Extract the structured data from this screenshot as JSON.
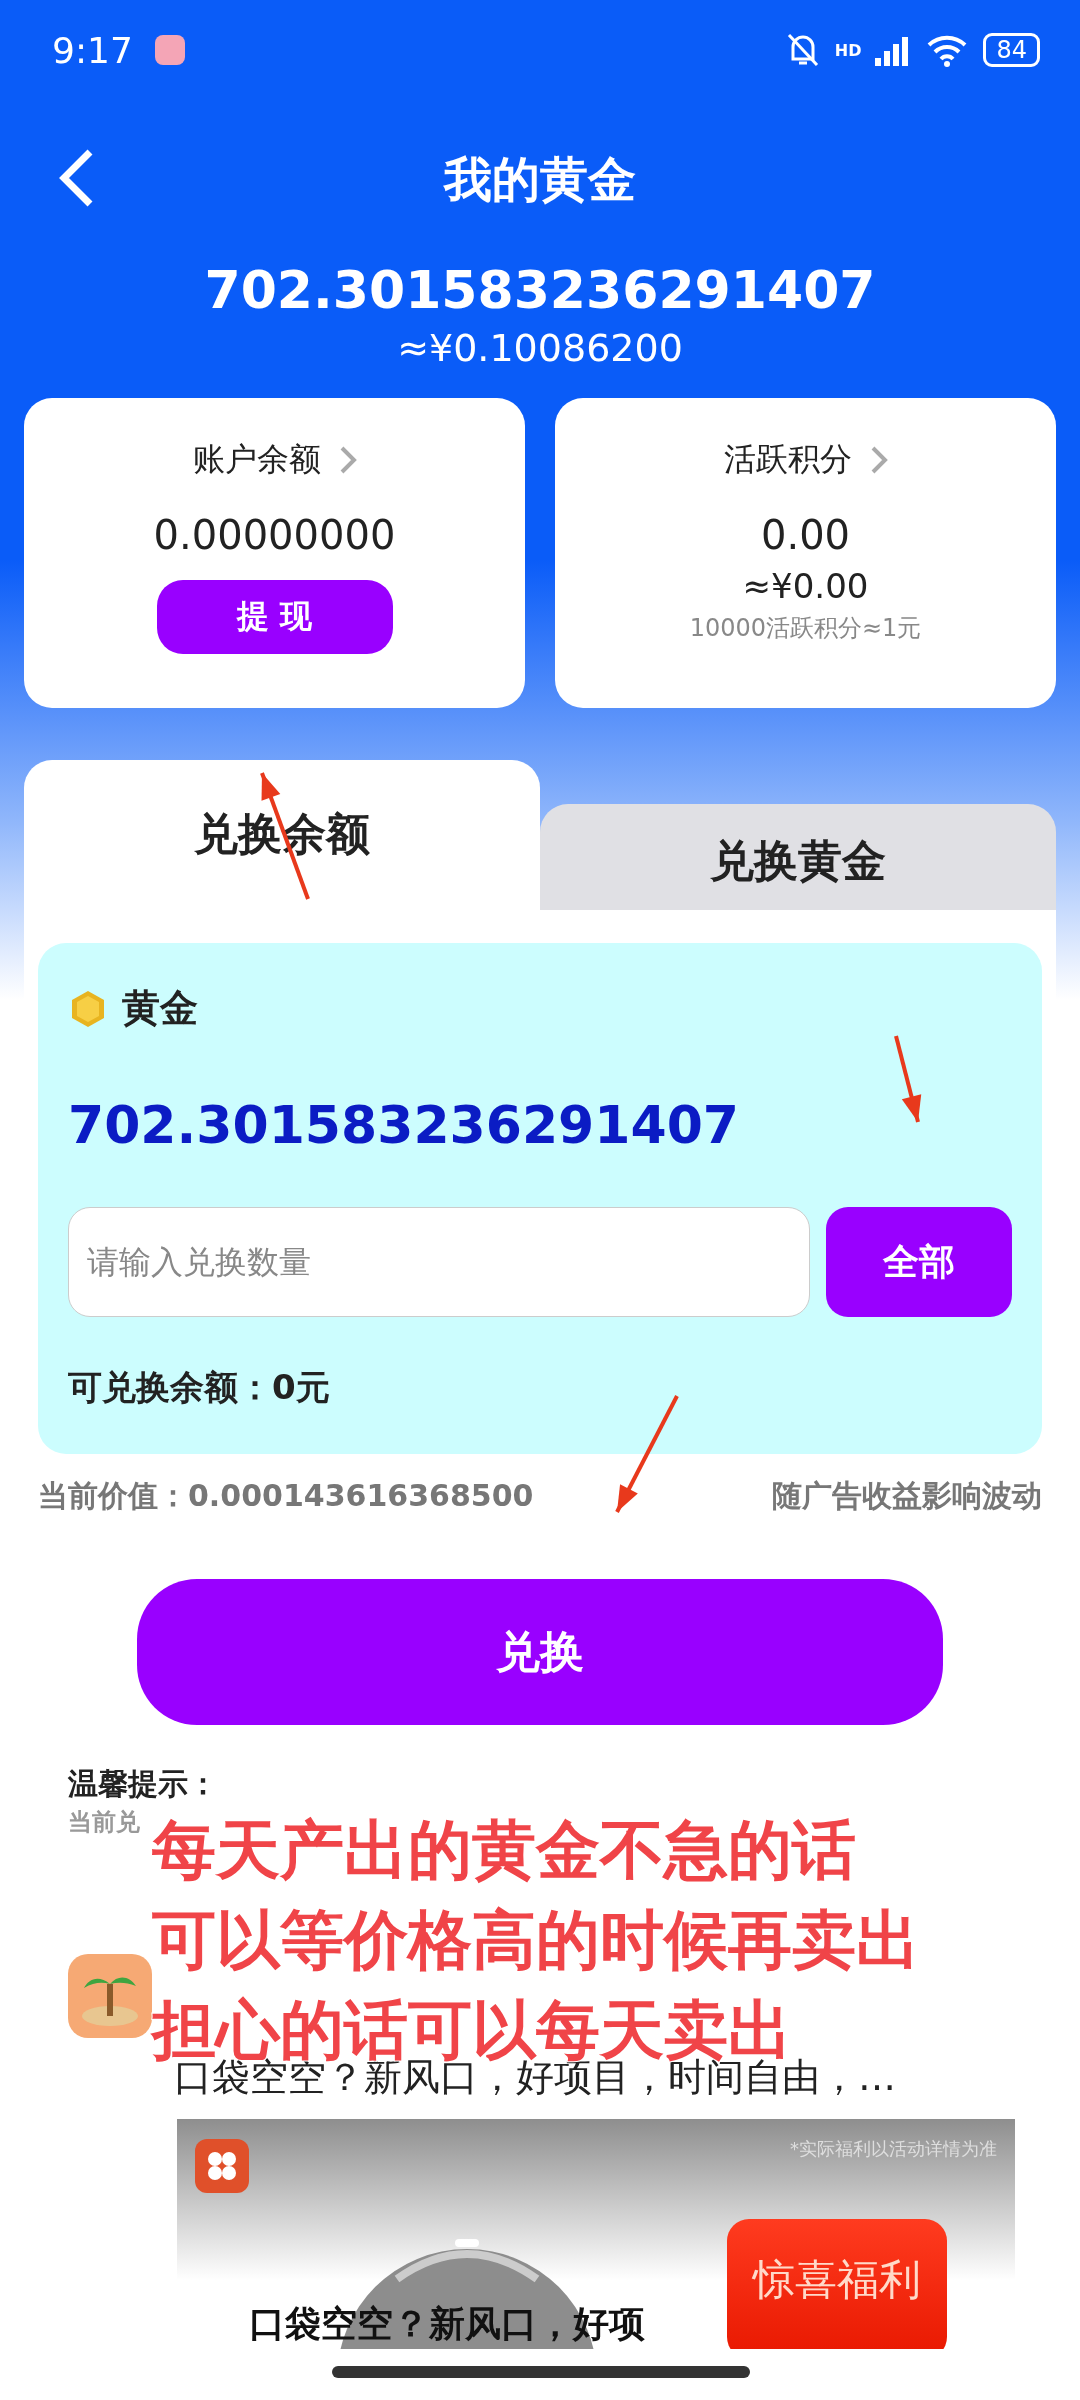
{
  "status_bar": {
    "time": "9:17",
    "network": "HD",
    "battery": "84"
  },
  "header": {
    "title": "我的黄金"
  },
  "gold": {
    "amount": "702.301583236291407",
    "approx": "≈¥0.10086200"
  },
  "cards": [
    {
      "kind": "balance",
      "title": "账户余额",
      "value": "0.00000000",
      "button": "提 现"
    },
    {
      "kind": "points",
      "title": "活跃积分",
      "value": "0.00",
      "approx": "≈¥0.00",
      "note": "10000活跃积分≈1元"
    }
  ],
  "tabs": [
    {
      "label": "兑换余额",
      "selected": true
    },
    {
      "label": "兑换黄金",
      "selected": false
    }
  ],
  "exchange": {
    "label": "黄金",
    "amount": "702.301583236291407",
    "placeholder": "请输入兑换数量",
    "all_button": "全部",
    "available": "可兑换余额：0元"
  },
  "price": {
    "current": "当前价值：0.000143616368500",
    "note": "随广告收益影响波动"
  },
  "submit": "兑换",
  "tips": {
    "title": "温馨提示：",
    "text": "当前兑"
  },
  "ad": {
    "title": "口袋空空？新风口，好项目，时间自由，…",
    "disclaimer": "*实际福利以活动详情为准",
    "cta": "惊喜福利",
    "caption": "口袋空空？新风口，好项"
  },
  "annotation": {
    "lines": [
      "每天产出的黄金不急的话",
      "可以等价格高的时候再卖出",
      "担心的话可以每天卖出"
    ]
  }
}
